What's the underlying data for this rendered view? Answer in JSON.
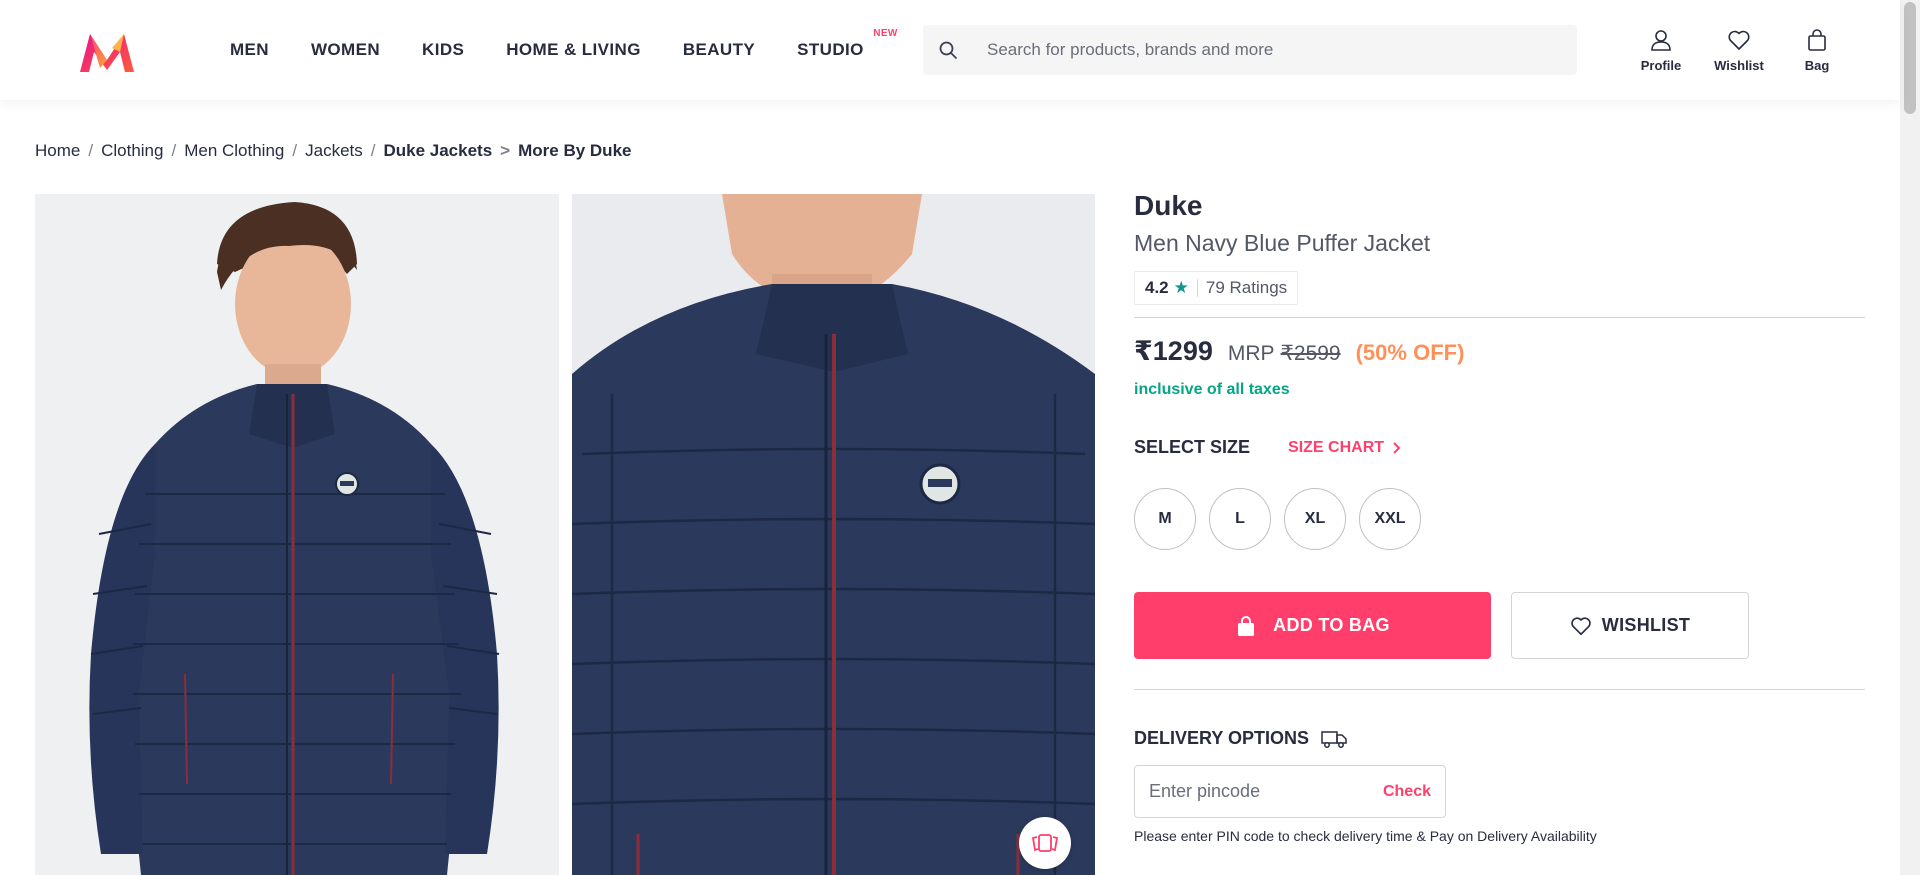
{
  "header": {
    "logo_alt": "Myntra",
    "nav": [
      {
        "label": "MEN"
      },
      {
        "label": "WOMEN"
      },
      {
        "label": "KIDS"
      },
      {
        "label": "HOME & LIVING"
      },
      {
        "label": "BEAUTY"
      },
      {
        "label": "STUDIO",
        "tag": "NEW"
      }
    ],
    "search_placeholder": "Search for products, brands and more",
    "actions": [
      {
        "label": "Profile",
        "icon": "profile-icon"
      },
      {
        "label": "Wishlist",
        "icon": "heart-icon"
      },
      {
        "label": "Bag",
        "icon": "bag-icon"
      }
    ]
  },
  "breadcrumb": {
    "items": [
      "Home",
      "Clothing",
      "Men Clothing",
      "Jackets"
    ],
    "current": "Duke Jackets",
    "arrow": ">",
    "more": "More By Duke"
  },
  "product": {
    "brand": "Duke",
    "name": "Men Navy Blue Puffer Jacket",
    "rating": "4.2",
    "rating_count": "79 Ratings",
    "price": "₹1299",
    "mrp_label": "MRP",
    "mrp": "₹2599",
    "discount": "(50% OFF)",
    "taxes": "inclusive of all taxes",
    "select_size": "SELECT SIZE",
    "size_chart": "SIZE CHART",
    "sizes": [
      "M",
      "L",
      "XL",
      "XXL"
    ],
    "add_to_bag": "ADD TO BAG",
    "wishlist": "WISHLIST",
    "delivery_title": "DELIVERY OPTIONS",
    "pincode_placeholder": "Enter pincode",
    "check": "Check",
    "pincode_note": "Please enter PIN code to check delivery time & Pay on Delivery Availability"
  },
  "colors": {
    "brand_pink": "#ff3f6c",
    "discount_orange": "#ff905a",
    "tax_green": "#03a685",
    "rating_star": "#14958f",
    "jacket_navy": "#2b3a5c"
  }
}
